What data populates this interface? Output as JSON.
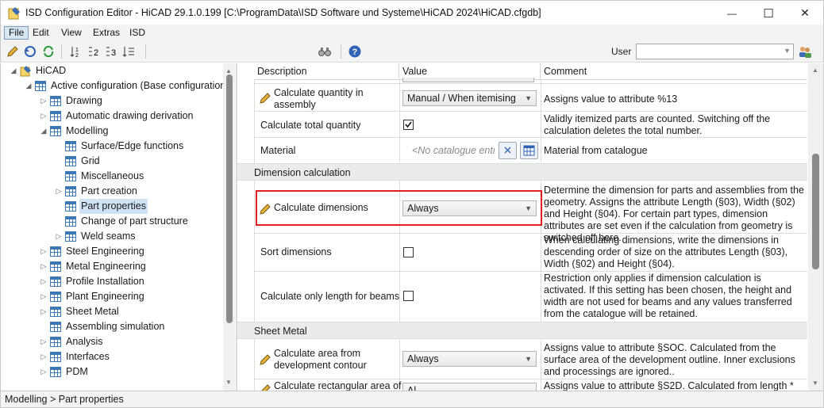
{
  "window": {
    "title": "ISD Configuration Editor  -  HiCAD 29.1.0.199 [C:\\ProgramData\\ISD Software und Systeme\\HiCAD 2024\\HiCAD.cfgdb]",
    "minimize_glyph": "—",
    "maximize_glyph": "☐",
    "close_glyph": "✕"
  },
  "menu": [
    "File",
    "Edit",
    "View",
    "Extras",
    "ISD"
  ],
  "toolbar": {
    "user_label": "User",
    "user_value": "",
    "icons": [
      "pencil-icon",
      "undo-icon",
      "refresh-icon",
      "sort-icon-1",
      "sort-icon-2",
      "sort-icon-3",
      "sort-icon-4",
      "binoculars-icon",
      "help-icon",
      "user-icon"
    ]
  },
  "tree": [
    {
      "label": "HiCAD",
      "depth": 0,
      "expander": "◢",
      "icon": "hicad-icon"
    },
    {
      "label": "Active configuration (Base configuration)",
      "depth": 1,
      "expander": "◢",
      "icon": "grid-icon"
    },
    {
      "label": "Drawing",
      "depth": 2,
      "expander": "▷",
      "icon": "grid-icon"
    },
    {
      "label": "Automatic drawing derivation",
      "depth": 2,
      "expander": "▷",
      "icon": "grid-icon"
    },
    {
      "label": "Modelling",
      "depth": 2,
      "expander": "◢",
      "icon": "grid-icon"
    },
    {
      "label": "Surface/Edge functions",
      "depth": 3,
      "expander": "",
      "icon": "grid-icon"
    },
    {
      "label": "Grid",
      "depth": 3,
      "expander": "",
      "icon": "grid-icon"
    },
    {
      "label": "Miscellaneous",
      "depth": 3,
      "expander": "",
      "icon": "grid-icon"
    },
    {
      "label": "Part creation",
      "depth": 3,
      "expander": "▷",
      "icon": "grid-icon"
    },
    {
      "label": "Part properties",
      "depth": 3,
      "expander": "",
      "icon": "grid-icon",
      "selected": true
    },
    {
      "label": "Change of part structure",
      "depth": 3,
      "expander": "",
      "icon": "grid-icon"
    },
    {
      "label": "Weld seams",
      "depth": 3,
      "expander": "▷",
      "icon": "grid-icon"
    },
    {
      "label": "Steel Engineering",
      "depth": 2,
      "expander": "▷",
      "icon": "grid-icon"
    },
    {
      "label": "Metal Engineering",
      "depth": 2,
      "expander": "▷",
      "icon": "grid-icon"
    },
    {
      "label": "Profile Installation",
      "depth": 2,
      "expander": "▷",
      "icon": "grid-icon"
    },
    {
      "label": "Plant Engineering",
      "depth": 2,
      "expander": "▷",
      "icon": "grid-icon"
    },
    {
      "label": "Sheet Metal",
      "depth": 2,
      "expander": "▷",
      "icon": "grid-icon"
    },
    {
      "label": "Assembling simulation",
      "depth": 2,
      "expander": "",
      "icon": "grid-icon"
    },
    {
      "label": "Analysis",
      "depth": 2,
      "expander": "▷",
      "icon": "grid-icon"
    },
    {
      "label": "Interfaces",
      "depth": 2,
      "expander": "▷",
      "icon": "grid-icon"
    },
    {
      "label": "PDM",
      "depth": 2,
      "expander": "▷",
      "icon": "grid-icon"
    }
  ],
  "table": {
    "headers": [
      "Description",
      "Value",
      "Comment"
    ],
    "rows": {
      "r1": {
        "desc": "Calculate quantity in assembly",
        "value": "Manual / When itemising",
        "comment": "Assigns value to attribute %13"
      },
      "r2": {
        "desc": "Calculate total quantity",
        "value": "checked",
        "comment": "Validly itemized parts are counted. Switching off the calculation deletes the total number."
      },
      "r3": {
        "desc": "Material",
        "placeholder": "<No catalogue entr",
        "comment": "Material from catalogue"
      },
      "section1": "Dimension calculation",
      "r4": {
        "desc": "Calculate dimensions",
        "value": "Always",
        "comment": "Determine the dimension for parts and assemblies from the geometry. Assigns the attribute Length (§03), Width (§02) and Height (§04). For certain part types, dimension attributes are set even if the calculation from geometry is switched off here."
      },
      "r5": {
        "desc": "Sort dimensions",
        "value": "unchecked",
        "comment": "When calculating dimensions, write the dimensions in descending order of size on the attributes Length (§03), Width (§02) and Height (§04)."
      },
      "r6": {
        "desc": "Calculate only length for beams",
        "value": "unchecked",
        "comment": "Restriction only applies if dimension calculation is activated. If this setting has been chosen, the height and width are not used for beams and any values transferred from the catalogue will be retained."
      },
      "section2": "Sheet Metal",
      "r7": {
        "desc": "Calculate area from development contour",
        "value": "Always",
        "comment": "Assigns value to attribute §SOC. Calculated from the surface area of the development outline. Inner exclusions and processings are ignored.."
      },
      "r8": {
        "desc": "Calculate rectangular area of",
        "value": "Al",
        "comment": "Assigns value to attribute §S2D. Calculated from length *"
      }
    }
  },
  "status": "Modelling > Part properties",
  "colors": {
    "highlight": "#e02020",
    "selection": "#cfe3f5",
    "section_bg": "#ebebeb"
  }
}
